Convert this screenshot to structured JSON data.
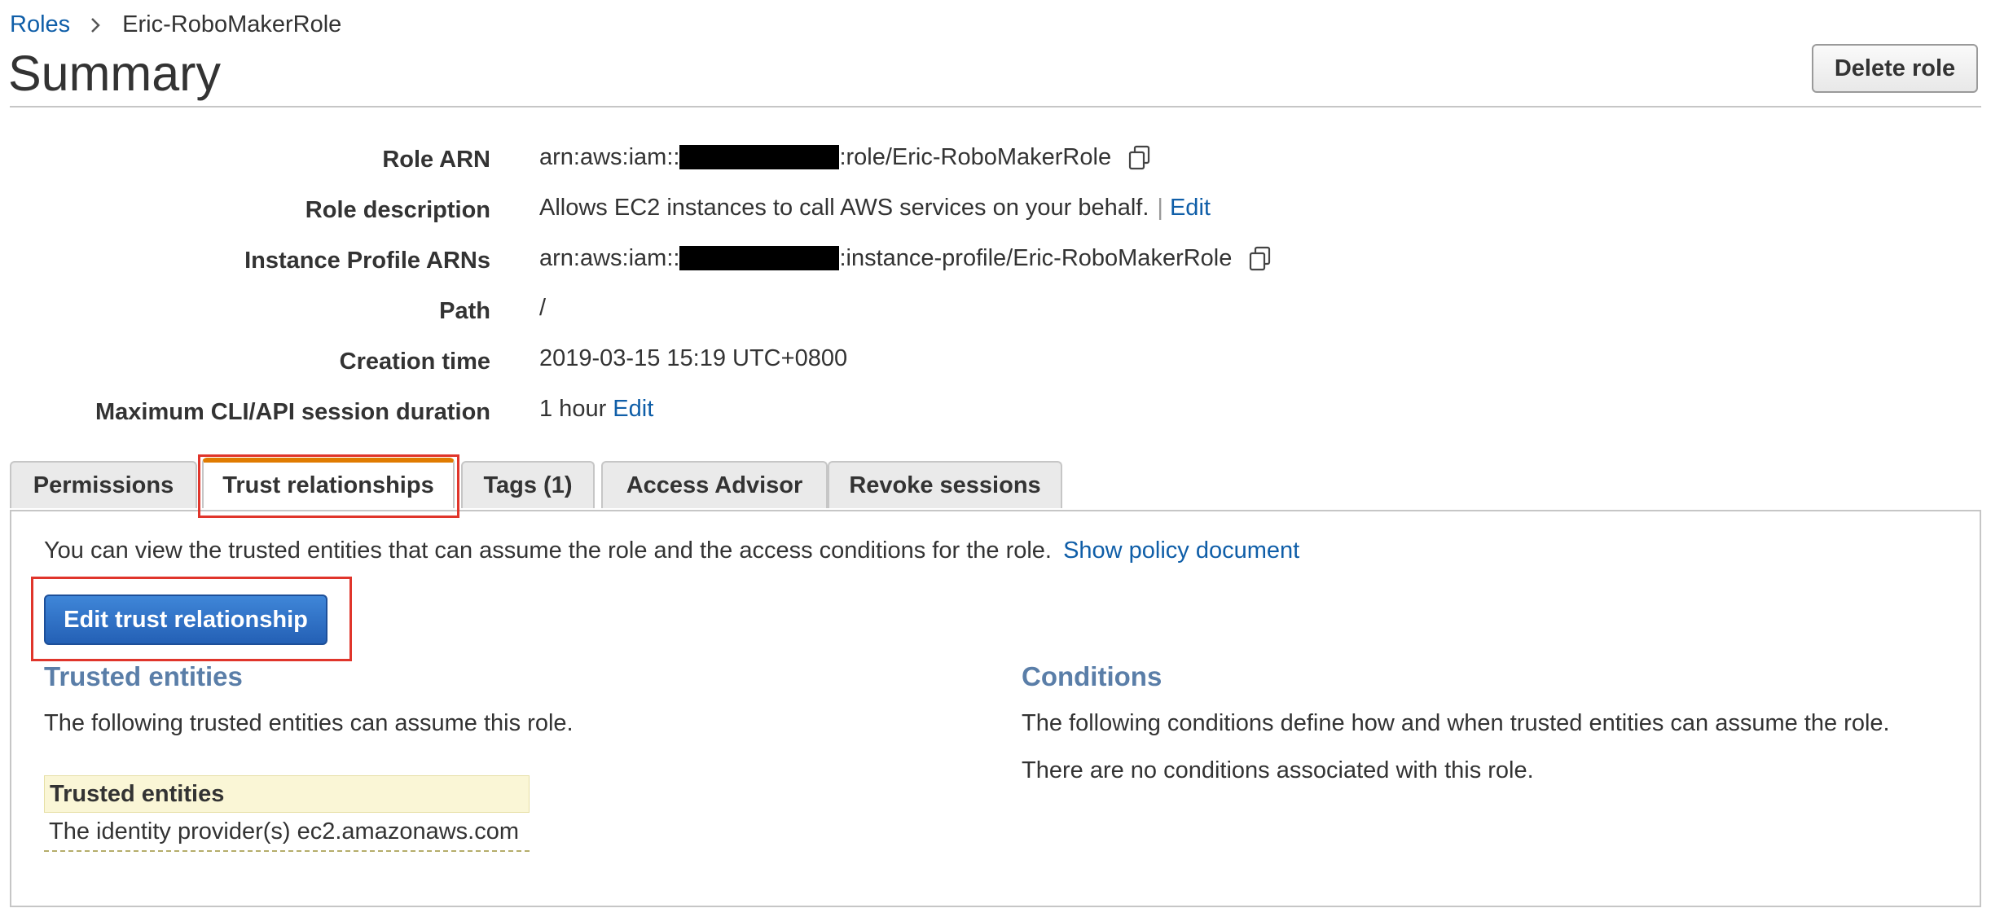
{
  "breadcrumb": {
    "parent": "Roles",
    "current": "Eric-RoboMakerRole"
  },
  "page_title": "Summary",
  "delete_button": "Delete role",
  "fields": {
    "role_arn": {
      "label": "Role ARN",
      "prefix": "arn:aws:iam::",
      "suffix": ":role/Eric-RoboMakerRole"
    },
    "role_description": {
      "label": "Role description",
      "value": "Allows EC2 instances to call AWS services on your behalf.",
      "separator": "|",
      "edit": "Edit"
    },
    "instance_profile": {
      "label": "Instance Profile ARNs",
      "prefix": "arn:aws:iam::",
      "suffix": ":instance-profile/Eric-RoboMakerRole"
    },
    "path": {
      "label": "Path",
      "value": "/"
    },
    "creation_time": {
      "label": "Creation time",
      "value": "2019-03-15 15:19 UTC+0800"
    },
    "session_duration": {
      "label": "Maximum CLI/API session duration",
      "value": "1 hour",
      "edit": "Edit"
    }
  },
  "tabs": [
    {
      "label": "Permissions",
      "active": false
    },
    {
      "label": "Trust relationships",
      "active": true
    },
    {
      "label": "Tags (1)",
      "active": false
    },
    {
      "label": "Access Advisor",
      "active": false
    },
    {
      "label": "Revoke sessions",
      "active": false
    }
  ],
  "trust": {
    "description": "You can view the trusted entities that can assume the role and the access conditions for the role.",
    "show_policy_link": "Show policy document",
    "edit_button": "Edit trust relationship",
    "trusted_entities": {
      "heading": "Trusted entities",
      "text": "The following trusted entities can assume this role.",
      "table_header": "Trusted entities",
      "rows": [
        "The identity provider(s) ec2.amazonaws.com"
      ]
    },
    "conditions": {
      "heading": "Conditions",
      "text": "The following conditions define how and when trusted entities can assume the role.",
      "none_text": "There are no conditions associated with this role."
    }
  },
  "colors": {
    "link": "#0f5ea8",
    "primary_button": "#2c6fc8",
    "active_tab_accent": "#e07b00",
    "highlight_box": "#e0352b",
    "section_heading": "#5a7ea8"
  }
}
